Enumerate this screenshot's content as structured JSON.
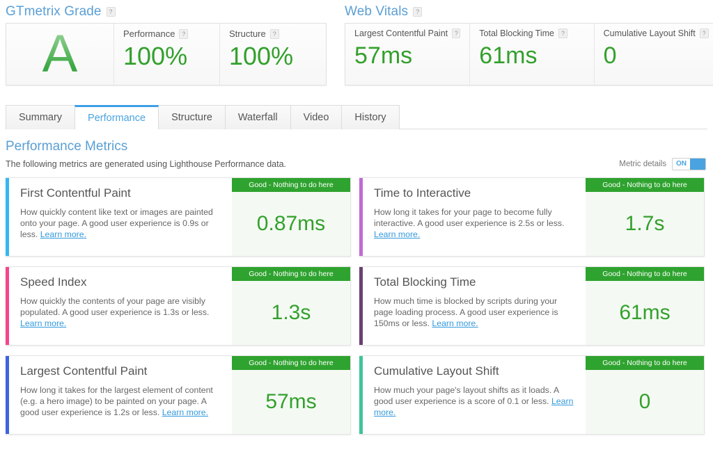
{
  "grade_section": {
    "title": "GTmetrix Grade",
    "help": "?",
    "grade": "A",
    "scores": [
      {
        "label": "Performance",
        "value": "100%"
      },
      {
        "label": "Structure",
        "value": "100%"
      }
    ]
  },
  "vitals_section": {
    "title": "Web Vitals",
    "help": "?",
    "items": [
      {
        "label": "Largest Contentful Paint",
        "value": "57ms"
      },
      {
        "label": "Total Blocking Time",
        "value": "61ms"
      },
      {
        "label": "Cumulative Layout Shift",
        "value": "0"
      }
    ]
  },
  "tabs": [
    {
      "label": "Summary",
      "active": false
    },
    {
      "label": "Performance",
      "active": true
    },
    {
      "label": "Structure",
      "active": false
    },
    {
      "label": "Waterfall",
      "active": false
    },
    {
      "label": "Video",
      "active": false
    },
    {
      "label": "History",
      "active": false
    }
  ],
  "section": {
    "title": "Performance Metrics",
    "subtitle": "The following metrics are generated using Lighthouse Performance data.",
    "toggle_label": "Metric details",
    "toggle_state": "ON"
  },
  "colors": {
    "accent_blue": "#3da0e8",
    "green": "#33a02c",
    "badge_green": "#2fa32f",
    "link_blue": "#3399dd",
    "heading_blue": "#5a9fd4"
  },
  "metrics": [
    {
      "name": "First Contentful Paint",
      "description": "How quickly content like text or images are painted onto your page. A good user experience is 0.9s or less.",
      "link": "Learn more.",
      "badge": "Good - Nothing to do here",
      "value": "0.87ms",
      "accent": "#35b7f0"
    },
    {
      "name": "Time to Interactive",
      "description": "How long it takes for your page to become fully interactive. A good user experience is 2.5s or less.",
      "link": "Learn more.",
      "badge": "Good - Nothing to do here",
      "value": "1.7s",
      "accent": "#bf6ad6"
    },
    {
      "name": "Speed Index",
      "description": "How quickly the contents of your page are visibly populated. A good user experience is 1.3s or less.",
      "link": "Learn more.",
      "badge": "Good - Nothing to do here",
      "value": "1.3s",
      "accent": "#f5458c"
    },
    {
      "name": "Total Blocking Time",
      "description": "How much time is blocked by scripts during your page loading process. A good user experience is 150ms or less.",
      "link": "Learn more.",
      "badge": "Good - Nothing to do here",
      "value": "61ms",
      "accent": "#6b3f73"
    },
    {
      "name": "Largest Contentful Paint",
      "description": "How long it takes for the largest element of content (e.g. a hero image) to be painted on your page. A good user experience is 1.2s or less.",
      "link": "Learn more.",
      "badge": "Good - Nothing to do here",
      "value": "57ms",
      "accent": "#3f63e0"
    },
    {
      "name": "Cumulative Layout Shift",
      "description": "How much your page's layout shifts as it loads. A good user experience is a score of 0.1 or less.",
      "link": "Learn more.",
      "badge": "Good - Nothing to do here",
      "value": "0",
      "accent": "#3fc49a"
    }
  ]
}
